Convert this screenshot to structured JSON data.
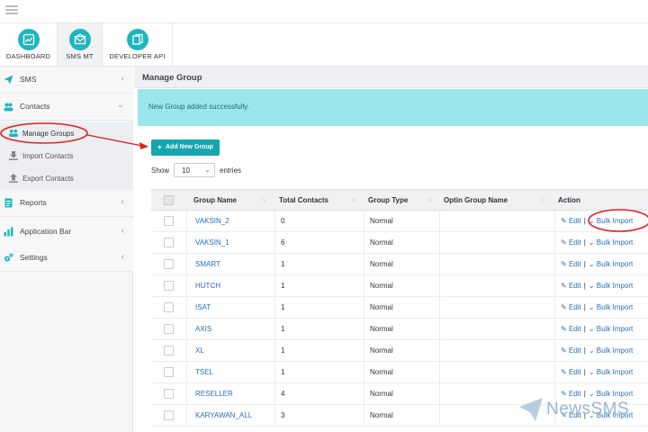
{
  "modules": [
    {
      "label": "DASHBOARD",
      "icon": "chart-icon"
    },
    {
      "label": "SMS MT",
      "icon": "envelope-icon"
    },
    {
      "label": "DEVELOPER API",
      "icon": "document-icon"
    }
  ],
  "sidebar": {
    "sms": "SMS",
    "contacts": "Contacts",
    "manage_groups": "Manage Groups",
    "import_contacts": "Import Contacts",
    "export_contacts": "Export Contacts",
    "reports": "Reports",
    "application_bar": "Application Bar",
    "settings": "Settings"
  },
  "main": {
    "title": "Manage Group",
    "alert": "New Group added successfully.",
    "add_button": "Add New Group",
    "show_label": "Show",
    "entries_value": "10",
    "entries_label": "entries"
  },
  "table": {
    "headers": [
      "Group Name",
      "Total Contacts",
      "Group Type",
      "Optin Group Name",
      "Action"
    ],
    "action_edit": "Edit",
    "action_bulk": "Bulk Import",
    "rows": [
      {
        "name": "VAKSIN_2",
        "total": "0",
        "type": "Normal"
      },
      {
        "name": "VAKSIN_1",
        "total": "6",
        "type": "Normal"
      },
      {
        "name": "SMART",
        "total": "1",
        "type": "Normal"
      },
      {
        "name": "HUTCH",
        "total": "1",
        "type": "Normal"
      },
      {
        "name": "ISAT",
        "total": "1",
        "type": "Normal"
      },
      {
        "name": "AXIS",
        "total": "1",
        "type": "Normal"
      },
      {
        "name": "XL",
        "total": "1",
        "type": "Normal"
      },
      {
        "name": "TSEL",
        "total": "1",
        "type": "Normal"
      },
      {
        "name": "RESELLER",
        "total": "4",
        "type": "Normal"
      },
      {
        "name": "KARYAWAN_ALL",
        "total": "3",
        "type": "Normal"
      }
    ]
  },
  "watermark": "NewsSMS",
  "colors": {
    "accent": "#1eb7c0",
    "link": "#2a6fb4",
    "annotation": "#e02020",
    "alert_bg": "#9be6ea"
  }
}
